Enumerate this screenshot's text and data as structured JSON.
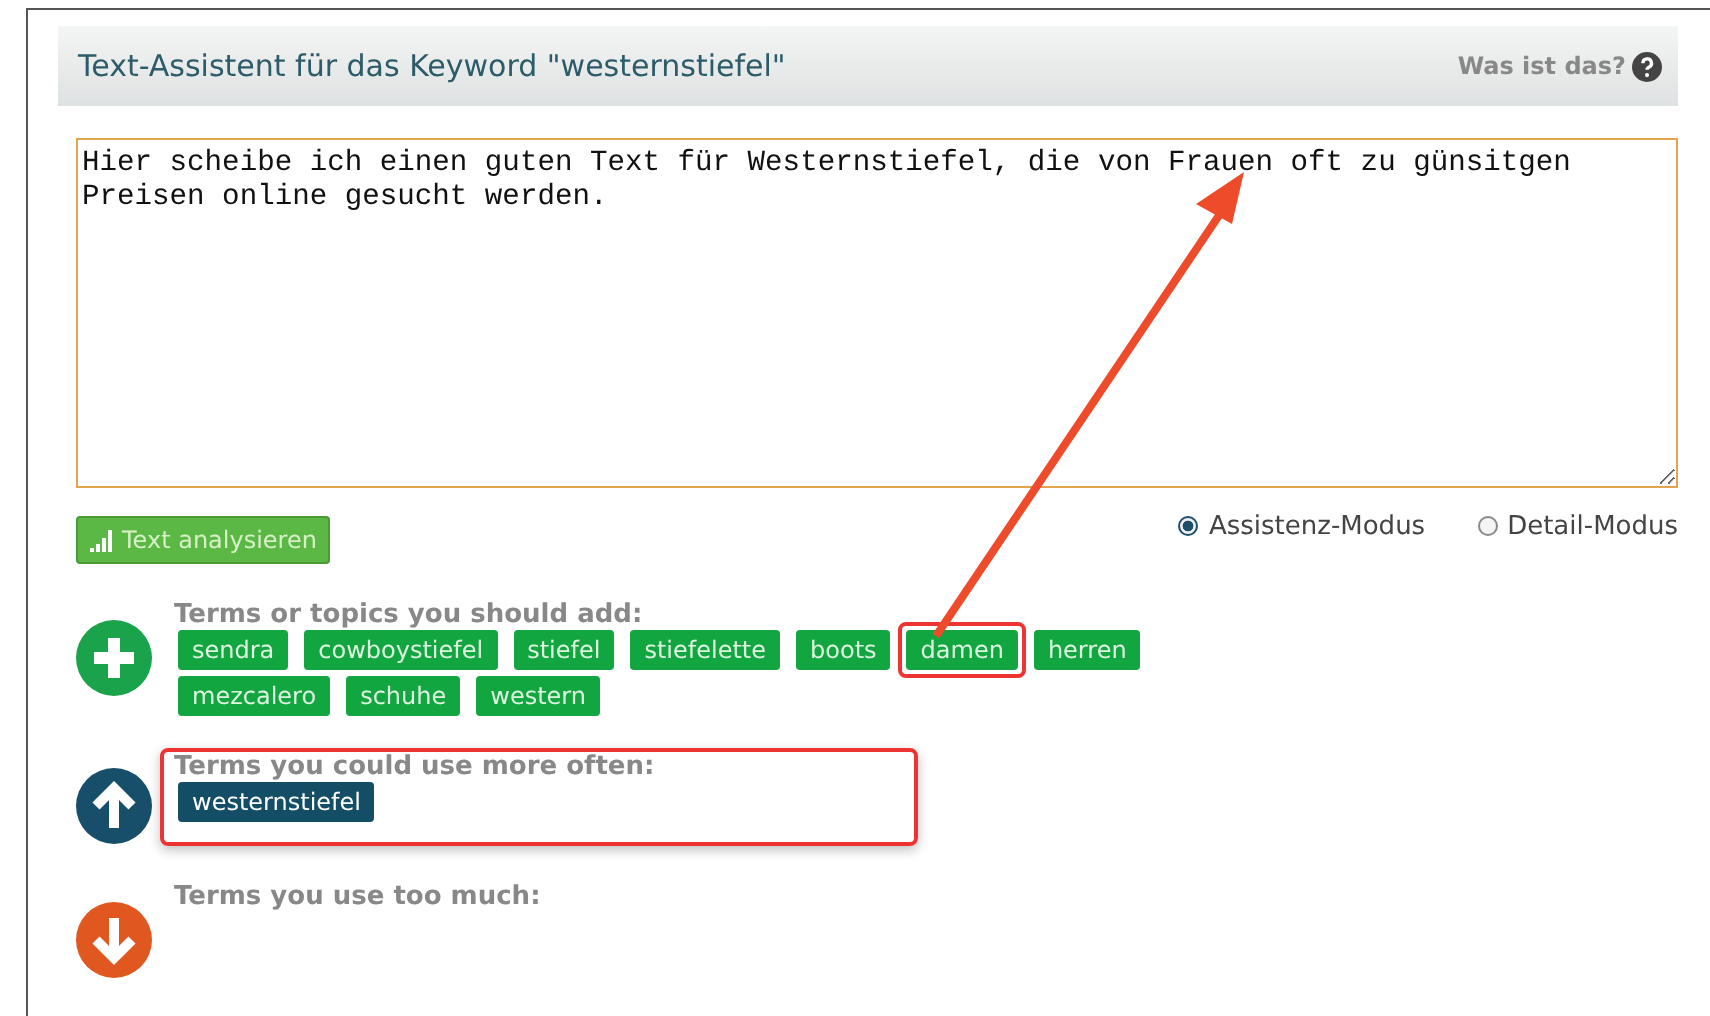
{
  "header": {
    "title": "Text-Assistent für das Keyword \"westernstiefel\"",
    "help": "Was ist das?"
  },
  "editor": {
    "value": "Hier scheibe ich einen guten Text für Westernstiefel, die von Frauen oft zu günsitgen Preisen online gesucht werden."
  },
  "analyze_button": "Text analysieren",
  "modes": [
    {
      "label": "Assistenz-Modus",
      "selected": true
    },
    {
      "label": "Detail-Modus",
      "selected": false
    }
  ],
  "sections": [
    {
      "kind": "add",
      "title": "Terms or topics you should add:",
      "highlighted": false,
      "terms": [
        {
          "label": "sendra",
          "highlighted": false
        },
        {
          "label": "cowboystiefel",
          "highlighted": false
        },
        {
          "label": "stiefel",
          "highlighted": false
        },
        {
          "label": "stiefelette",
          "highlighted": false
        },
        {
          "label": "boots",
          "highlighted": false
        },
        {
          "label": "damen",
          "highlighted": true
        },
        {
          "label": "herren",
          "highlighted": false
        },
        {
          "label": "mezcalero",
          "highlighted": false
        },
        {
          "label": "schuhe",
          "highlighted": false
        },
        {
          "label": "western",
          "highlighted": false
        }
      ]
    },
    {
      "kind": "more",
      "title": "Terms you could use more often:",
      "highlighted": true,
      "terms": [
        {
          "label": "westernstiefel",
          "highlighted": false
        }
      ]
    },
    {
      "kind": "less",
      "title": "Terms you use too much:",
      "highlighted": false
    }
  ]
}
